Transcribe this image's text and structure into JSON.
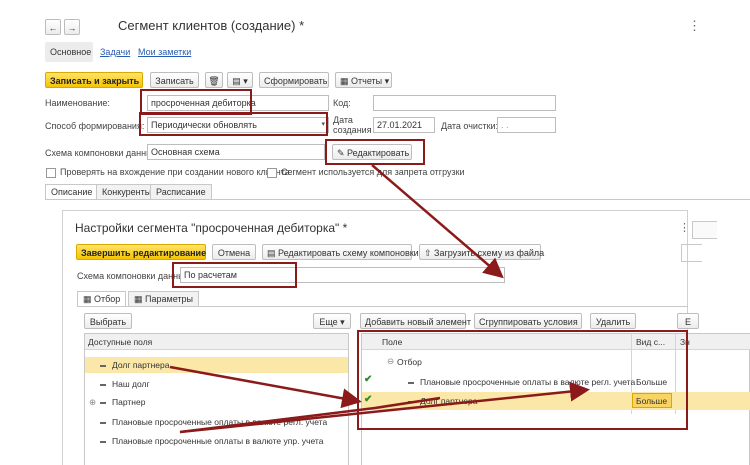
{
  "window": {
    "title": "Сегмент клиентов (создание) *",
    "tabs": [
      "Основное",
      "Задачи",
      "Мои заметки"
    ]
  },
  "toolbar": {
    "save_close": "Записать и закрыть",
    "save": "Записать",
    "form": "Сформировать",
    "reports": "Отчеты"
  },
  "form": {
    "name_label": "Наименование:",
    "name_value": "просроченная дебиторка",
    "code_label": "Код:",
    "method_label": "Способ формирования:",
    "method_value": "Периодически обновлять",
    "date_label1": "Дата",
    "date_label2": "создания",
    "date_value": "27.01.2021",
    "clear_date_label": "Дата очистки:",
    "clear_date_value": ". .",
    "scheme_label": "Схема компоновки данных:",
    "scheme_value": "Основная схема",
    "edit_button": "Редактировать",
    "check1": "Проверять на вхождение при создании нового клиента",
    "check2": "Сегмент используется для запрета отгрузки"
  },
  "subtabs": [
    "Описание",
    "Конкуренты",
    "Расписание"
  ],
  "settings": {
    "title": "Настройки сегмента \"просроченная дебиторка\" *",
    "finish": "Завершить редактирование",
    "cancel": "Отмена",
    "edit_scheme": "Редактировать схему компоновки",
    "load_scheme": "Загрузить схему из файла",
    "scheme_label": "Схема компоновки данных:",
    "scheme_value": "По расчетам",
    "tab_filter": "Отбор",
    "tab_params": "Параметры",
    "select": "Выбрать",
    "more": "Еще",
    "add_element": "Добавить новый элемент",
    "group_conditions": "Сгруппировать условия",
    "delete": "Удалить",
    "cut_button": "Е",
    "available_header": "Доступные поля",
    "available_fields": [
      "Долг партнера",
      "Наш долг",
      "Партнер",
      "Плановые просроченные оплаты в валюте регл. учета",
      "Плановые просроченные оплаты в валюте упр. учета"
    ],
    "right_header_field": "Поле",
    "right_header_view": "Вид с...",
    "right_header_value": "Зн",
    "filter_group": "Отбор",
    "filter_rows": [
      {
        "field": "Плановые просроченные оплаты в валюте регл. учета",
        "view": "Больше"
      },
      {
        "field": "Долг партнера",
        "view": "Больше"
      }
    ]
  }
}
